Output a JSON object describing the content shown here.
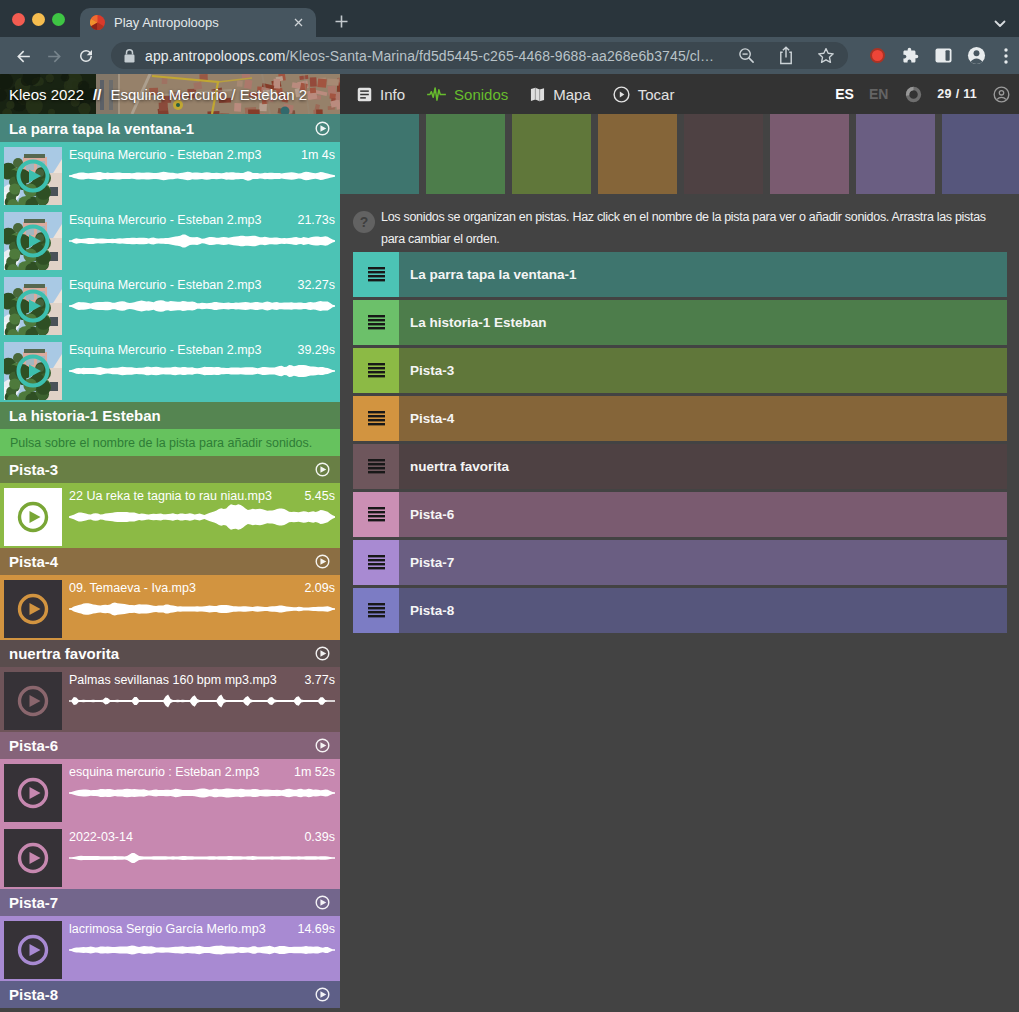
{
  "browser": {
    "tab_title": "Play Antropoloops",
    "url_domain": "app.antropoloops.com",
    "url_path": "/Kleos-Santa-Marina/fd5d5445-c265-4468-9688-aa268e6b3745/cl…",
    "icons": [
      "back-icon",
      "forward-icon",
      "reload-icon",
      "lock-icon",
      "zoom-out-icon",
      "share-icon",
      "star-icon",
      "record-dot-icon",
      "extensions-puzzle-icon",
      "side-panel-icon",
      "profile-avatar-icon",
      "kebab-menu-icon",
      "new-tab-plus-icon",
      "tab-close-icon",
      "tab-strip-chevron-icon"
    ]
  },
  "app_header": {
    "project": "Kleos 2022",
    "separator": "//",
    "title": "Esquina Mercurio / Esteban 2",
    "nav": [
      {
        "label": "Info",
        "icon": "info-icon",
        "active": false
      },
      {
        "label": "Sonidos",
        "icon": "waveform-icon",
        "active": true
      },
      {
        "label": "Mapa",
        "icon": "map-icon",
        "active": false
      },
      {
        "label": "Tocar",
        "icon": "play-circle-icon",
        "active": false
      }
    ],
    "lang_selected": "ES",
    "lang_other": "EN",
    "counter": "29 / 11",
    "accent_green": "#67bd2d"
  },
  "help": {
    "line1": "Los sonidos se organizan en pistas. Haz click en el nombre de la pista para ver o añadir sonidos. Arrastra las pistas",
    "line2": "para cambiar el orden."
  },
  "tracks": [
    {
      "name": "La parra tapa la ventana-1",
      "colors": {
        "header": "#47857C",
        "clip": "#4CC3B5",
        "bar": "#3E756E",
        "handle": "#4CC3B5",
        "play": "#3CBFAF"
      },
      "sidebar_play": true,
      "clips": [
        {
          "title": "Esquina Mercurio - Esteban 2.mp3",
          "duration": "1m 4s",
          "thumb": "photo",
          "h": 65,
          "wave": {
            "seed": 11,
            "jitter": 2.0,
            "base": 0.9,
            "env": [
              [
                0,
                2.5
              ],
              [
                0.08,
                3.5
              ],
              [
                0.2,
                3
              ],
              [
                0.35,
                3.5
              ],
              [
                0.5,
                3
              ],
              [
                0.65,
                3.5
              ],
              [
                0.8,
                3
              ],
              [
                0.9,
                3.5
              ],
              [
                1,
                2.5
              ]
            ]
          }
        },
        {
          "title": "Esquina Mercurio - Esteban 2.mp3",
          "duration": "21.73s",
          "thumb": "photo",
          "h": 65,
          "wave": {
            "seed": 22,
            "jitter": 2.2,
            "base": 0.9,
            "env": [
              [
                0,
                2.5
              ],
              [
                0.2,
                3
              ],
              [
                0.38,
                3
              ],
              [
                0.43,
                6.5
              ],
              [
                0.5,
                3
              ],
              [
                0.6,
                3.5
              ],
              [
                0.7,
                6
              ],
              [
                0.78,
                3.5
              ],
              [
                0.9,
                3.5
              ],
              [
                1,
                4
              ]
            ]
          }
        },
        {
          "title": "Esquina Mercurio - Esteban 2.mp3",
          "duration": "32.27s",
          "thumb": "photo",
          "h": 65,
          "wave": {
            "seed": 33,
            "jitter": 2.0,
            "base": 0.9,
            "env": [
              [
                0,
                3
              ],
              [
                0.15,
                3.5
              ],
              [
                0.3,
                4.5
              ],
              [
                0.38,
                5.5
              ],
              [
                0.5,
                3
              ],
              [
                0.62,
                3.5
              ],
              [
                0.75,
                4
              ],
              [
                0.9,
                3
              ],
              [
                0.96,
                6
              ],
              [
                1,
                2.5
              ]
            ]
          }
        },
        {
          "title": "Esquina Mercurio - Esteban 2.mp3",
          "duration": "39.29s",
          "thumb": "photo",
          "h": 65,
          "wave": {
            "seed": 44,
            "jitter": 2.0,
            "base": 0.9,
            "env": [
              [
                0,
                2.5
              ],
              [
                0.2,
                3.5
              ],
              [
                0.4,
                4
              ],
              [
                0.55,
                3.5
              ],
              [
                0.7,
                3
              ],
              [
                0.85,
                6.5
              ],
              [
                0.93,
                4
              ],
              [
                1,
                3.5
              ]
            ]
          }
        }
      ]
    },
    {
      "name": "La historia-1 Esteban",
      "colors": {
        "header": "#558551",
        "clip": "#66C25E",
        "bar": "#4D7D4B",
        "handle": "#6CC06A",
        "play": "#58A552"
      },
      "sidebar_play": false,
      "hint": "Pulsa sobre el nombre de la pista para añadir sonidos.",
      "hint_text_color": "#2e7d36",
      "clips": []
    },
    {
      "name": "Pista-3",
      "colors": {
        "header": "#697F45",
        "clip": "#8CBA45",
        "bar": "#60773A",
        "handle": "#8CBA45",
        "play": "#79A636"
      },
      "sidebar_play": true,
      "clips": [
        {
          "title": "22 Ua reka te tagnia to rau niau.mp3",
          "duration": "5.45s",
          "thumb": "white",
          "h": 65,
          "wave": {
            "seed": 55,
            "jitter": 2.5,
            "base": 1.0,
            "env": [
              [
                0,
                3
              ],
              [
                0.04,
                6
              ],
              [
                0.08,
                3
              ],
              [
                0.15,
                4
              ],
              [
                0.22,
                5
              ],
              [
                0.3,
                3
              ],
              [
                0.4,
                2.5
              ],
              [
                0.5,
                3
              ],
              [
                0.55,
                6
              ],
              [
                0.6,
                12
              ],
              [
                0.64,
                15
              ],
              [
                0.68,
                10
              ],
              [
                0.73,
                7
              ],
              [
                0.78,
                9
              ],
              [
                0.83,
                6
              ],
              [
                0.88,
                7
              ],
              [
                0.93,
                8
              ],
              [
                0.97,
                6
              ],
              [
                1,
                5
              ]
            ]
          }
        }
      ]
    },
    {
      "name": "Pista-4",
      "colors": {
        "header": "#8B6E43",
        "clip": "#D29440",
        "bar": "#856539",
        "handle": "#D29440",
        "play": "#D29440"
      },
      "sidebar_play": true,
      "clips": [
        {
          "title": "09. Temaeva - Iva.mp3",
          "duration": "2.09s",
          "thumb": "dark",
          "h": 65,
          "wave": {
            "seed": 66,
            "jitter": 1.8,
            "base": 1.0,
            "env": [
              [
                0,
                2
              ],
              [
                0.04,
                6
              ],
              [
                0.1,
                4.5
              ],
              [
                0.17,
                6
              ],
              [
                0.25,
                4
              ],
              [
                0.33,
                4.5
              ],
              [
                0.42,
                3
              ],
              [
                0.5,
                2.5
              ],
              [
                0.57,
                4
              ],
              [
                0.65,
                1.5
              ],
              [
                0.72,
                1.5
              ],
              [
                0.78,
                3
              ],
              [
                0.85,
                1.2
              ],
              [
                0.93,
                1.5
              ],
              [
                1,
                3
              ]
            ]
          }
        }
      ]
    },
    {
      "name": "nuertra favorita",
      "colors": {
        "header": "#5A4D4D",
        "clip": "#6E5459",
        "bar": "#4E4143",
        "handle": "#6E565C",
        "play": "#8A666D"
      },
      "sidebar_play": true,
      "clips": [
        {
          "title": "Palmas sevillanas 160 bpm mp3.mp3",
          "duration": "3.77s",
          "thumb": "dark",
          "h": 65,
          "wave": {
            "seed": 77,
            "jitter": 0.5,
            "base": 1.0,
            "type": "claps",
            "spikes": [
              [
                0.02,
                6
              ],
              [
                0.14,
                3.5
              ],
              [
                0.25,
                4.5
              ],
              [
                0.37,
                7
              ],
              [
                0.47,
                6
              ],
              [
                0.57,
                7
              ],
              [
                0.67,
                5
              ],
              [
                0.76,
                4
              ],
              [
                0.86,
                5
              ],
              [
                0.95,
                4
              ]
            ]
          }
        }
      ]
    },
    {
      "name": "Pista-6",
      "colors": {
        "header": "#856379",
        "clip": "#C788B0",
        "bar": "#7A5B70",
        "handle": "#CB8FB4",
        "play": "#C788B0"
      },
      "sidebar_play": true,
      "clips": [
        {
          "title": "esquina mercurio : Esteban 2.mp3",
          "duration": "1m 52s",
          "thumb": "dark",
          "h": 65,
          "wave": {
            "seed": 88,
            "jitter": 2.0,
            "base": 1.0,
            "env": [
              [
                0,
                3
              ],
              [
                0.2,
                3.5
              ],
              [
                0.4,
                3
              ],
              [
                0.55,
                4
              ],
              [
                0.7,
                3.5
              ],
              [
                0.85,
                3
              ],
              [
                1,
                3.5
              ]
            ]
          }
        },
        {
          "title": "2022-03-14",
          "duration": "0.39s",
          "thumb": "dark",
          "h": 65,
          "wave": {
            "seed": 99,
            "jitter": 0.35,
            "base": 0.9,
            "env": [
              [
                0,
                1.2
              ],
              [
                0.05,
                2
              ],
              [
                0.1,
                1.2
              ],
              [
                0.22,
                1
              ],
              [
                0.24,
                7
              ],
              [
                0.26,
                1
              ],
              [
                0.6,
                1
              ],
              [
                1,
                1
              ]
            ]
          }
        }
      ]
    },
    {
      "name": "Pista-7",
      "colors": {
        "header": "#73668C",
        "clip": "#A88AD2",
        "bar": "#6A5E82",
        "handle": "#A88AD2",
        "play": "#A88AD2"
      },
      "sidebar_play": true,
      "clips": [
        {
          "title": "lacrimosa Sergio García Merlo.mp3",
          "duration": "14.69s",
          "thumb": "dark",
          "h": 65,
          "wave": {
            "seed": 111,
            "jitter": 1.8,
            "base": 1.0,
            "env": [
              [
                0,
                2
              ],
              [
                0.1,
                3
              ],
              [
                0.25,
                3.5
              ],
              [
                0.4,
                3
              ],
              [
                0.55,
                3.5
              ],
              [
                0.7,
                3
              ],
              [
                0.85,
                3.2
              ],
              [
                1,
                2.5
              ]
            ]
          }
        }
      ]
    },
    {
      "name": "Pista-8",
      "colors": {
        "header": "#5E5F87",
        "clip": "#7C7CC4",
        "bar": "#56567C",
        "handle": "#7C7CC4",
        "play": "#7C7CC4"
      },
      "sidebar_play": true,
      "clips": []
    }
  ]
}
